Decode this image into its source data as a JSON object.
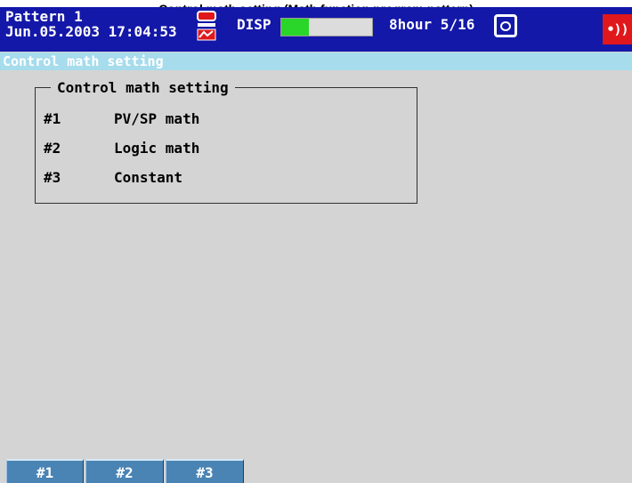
{
  "caption": "Control math setting (Math function program pattern)",
  "status_bar": {
    "pattern": "Pattern 1",
    "datetime": "Jun.05.2003 17:04:53",
    "disp_label": "DISP",
    "memory_fill": 0.3,
    "period": "8hour 5/16",
    "alarm_label": "•))",
    "icons": [
      "chart-icon",
      "camera-icon",
      "alarm-icon"
    ],
    "colors": {
      "background": "#1418a8",
      "bar_fill": "#2bd62b",
      "alarm": "#e0181c"
    }
  },
  "title_bar": {
    "label": "Control math setting",
    "color": "#a6dcec"
  },
  "menu": {
    "group_title": "Control math setting",
    "items": [
      {
        "num": "#1",
        "label": "PV/SP math"
      },
      {
        "num": "#2",
        "label": "Logic math"
      },
      {
        "num": "#3",
        "label": "Constant"
      }
    ]
  },
  "softkeys": [
    {
      "label": "#1"
    },
    {
      "label": "#2"
    },
    {
      "label": "#3"
    }
  ]
}
